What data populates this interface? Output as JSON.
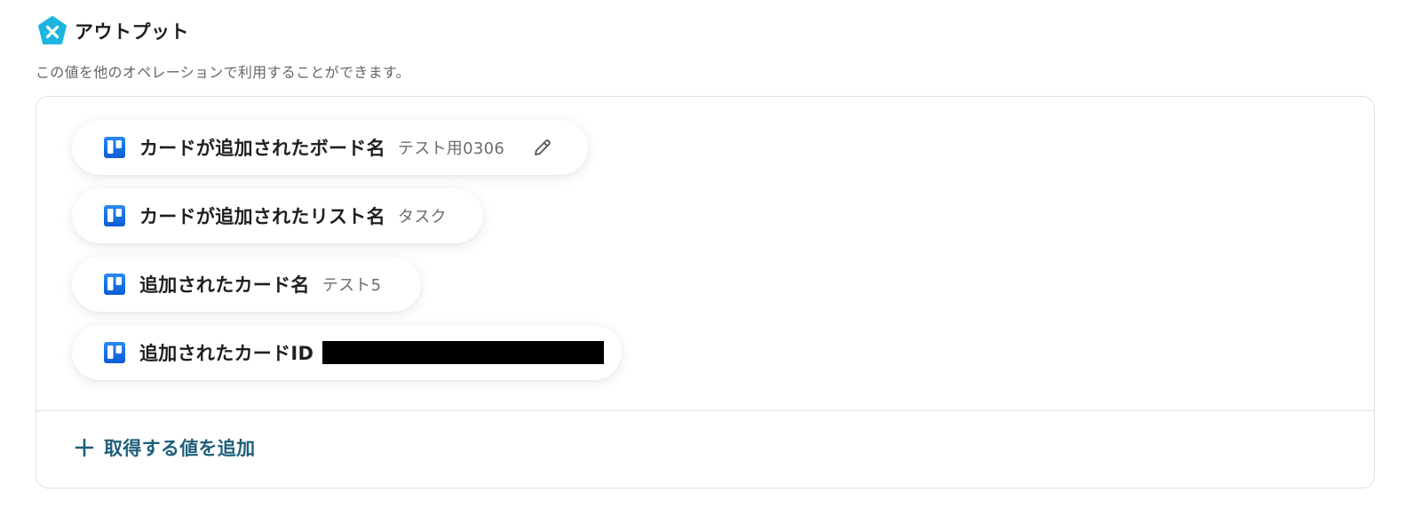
{
  "header": {
    "title": "アウトプット",
    "logo_icon": "yoom-logo-icon",
    "accent_color": "#1CB5E0"
  },
  "description": "この値を他のオペレーションで利用することができます。",
  "outputs": [
    {
      "label": "カードが追加されたボード名",
      "value": "テスト用0306",
      "icon": "trello-icon",
      "editable": true
    },
    {
      "label": "カードが追加されたリスト名",
      "value": "タスク",
      "icon": "trello-icon"
    },
    {
      "label": "追加されたカード名",
      "value": "テスト5",
      "icon": "trello-icon"
    },
    {
      "label": "追加されたカードID",
      "value": "",
      "redacted": true,
      "icon": "trello-icon"
    }
  ],
  "add_button": {
    "label": "取得する値を追加",
    "icon": "plus-icon",
    "color": "#1F5F7A"
  },
  "colors": {
    "trello_blue": "#1A73E8",
    "border": "#E2E2E2"
  }
}
